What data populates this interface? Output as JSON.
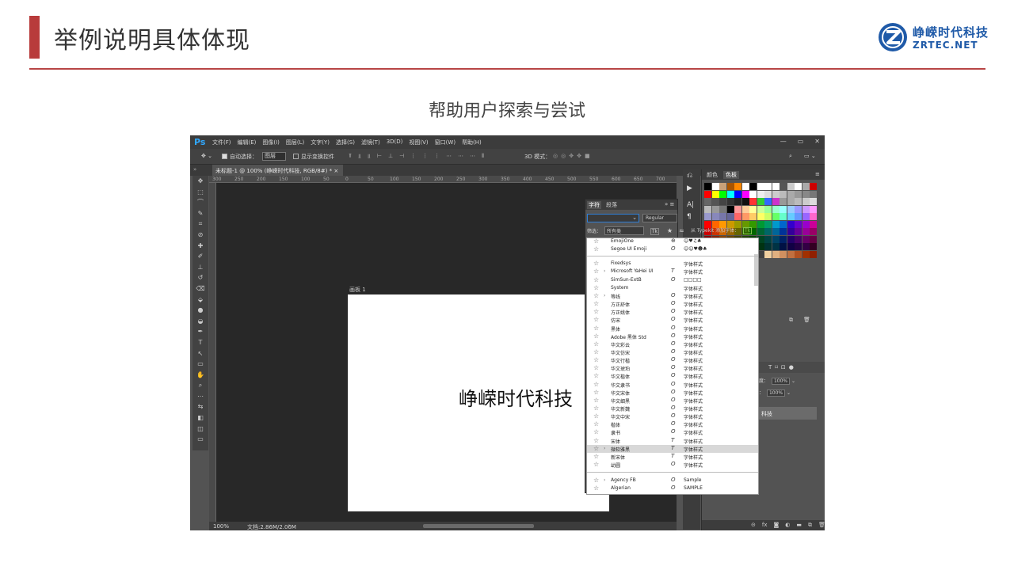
{
  "slide": {
    "title": "举例说明具体体现",
    "subtitle": "帮助用户探索与尝试",
    "logo_cn": "峥嵘时代科技",
    "logo_en": "ZRTEC.NET"
  },
  "ps": {
    "logo": "Ps",
    "menu": [
      "文件(F)",
      "编辑(E)",
      "图像(I)",
      "图层(L)",
      "文字(Y)",
      "选择(S)",
      "滤镜(T)",
      "3D(D)",
      "视图(V)",
      "窗口(W)",
      "帮助(H)"
    ],
    "options": {
      "auto_select_label": "自动选择：",
      "auto_select_value": "图层",
      "transform_label": "显示变换控件",
      "mode_3d": "3D 模式："
    },
    "doc_tab": "未标题-1 @ 100% (峥嵘时代科技, RGB/8#) *",
    "artboard_label": "画板 1",
    "canvas_text": "峥嵘时代科技",
    "status_zoom": "100%",
    "status_doc": "文档:2.86M/2.00M",
    "ruler_ticks": [
      "300",
      "250",
      "200",
      "150",
      "100",
      "50",
      "0",
      "50",
      "100",
      "150",
      "200",
      "250",
      "300",
      "350",
      "400",
      "450",
      "500",
      "550",
      "600",
      "650",
      "700"
    ],
    "tools": [
      "move-tool",
      "marquee-tool",
      "lasso-tool",
      "quick-select-tool",
      "crop-tool",
      "eyedropper-tool",
      "healing-tool",
      "brush-tool",
      "stamp-tool",
      "history-brush-tool",
      "eraser-tool",
      "bucket-tool",
      "blur-tool",
      "dodge-tool",
      "pen-tool",
      "type-tool",
      "path-select-tool",
      "rectangle-tool",
      "hand-tool",
      "zoom-tool",
      "more-tool",
      "swap-colors",
      "color-swatches",
      "mask-mode",
      "screen-mode"
    ],
    "right_panel": {
      "tab_color": "颜色",
      "tab_swatches": "色板",
      "opacity_label": "透明度：",
      "opacity_value": "100%",
      "fill_label": "填充：",
      "fill_value": "100%",
      "layer_name": "科技"
    },
    "character": {
      "tab_char": "字符",
      "tab_para": "段落",
      "style_value": "Regular",
      "filter_label": "筛选：",
      "filter_value": "所有类",
      "typekit_label": "从 Typekit 添加字体："
    },
    "fonts_top": [
      {
        "name": "EmojiOne",
        "type": "⊕",
        "sample": "☺♥♫♣"
      },
      {
        "name": "Segoe UI Emoji",
        "type": "O",
        "sample": "☺☺♥☻♣"
      }
    ],
    "fonts_mid": [
      {
        "name": "Fixedsys",
        "type": "",
        "sample": "字体样式",
        "exp": ""
      },
      {
        "name": "Microsoft YaHei UI",
        "type": "T",
        "sample": "字体样式",
        "exp": "›"
      },
      {
        "name": "SimSun-ExtB",
        "type": "O",
        "sample": "□□□□",
        "exp": ""
      },
      {
        "name": "System",
        "type": "",
        "sample": "字体样式",
        "exp": ""
      },
      {
        "name": "等线",
        "type": "O",
        "sample": "字体样式",
        "exp": "›"
      },
      {
        "name": "方正舒体",
        "type": "O",
        "sample": "字体样式",
        "exp": ""
      },
      {
        "name": "方正姚体",
        "type": "O",
        "sample": "字体样式",
        "exp": ""
      },
      {
        "name": "仿宋",
        "type": "O",
        "sample": "字体样式",
        "exp": ""
      },
      {
        "name": "黑体",
        "type": "O",
        "sample": "字体样式",
        "exp": ""
      },
      {
        "name": "Adobe 黑体 Std",
        "type": "O",
        "sample": "字体样式",
        "exp": ""
      },
      {
        "name": "华文彩云",
        "type": "O",
        "sample": "字体样式",
        "exp": ""
      },
      {
        "name": "华文仿宋",
        "type": "O",
        "sample": "字体样式",
        "exp": ""
      },
      {
        "name": "华文行楷",
        "type": "O",
        "sample": "字体样式",
        "exp": ""
      },
      {
        "name": "华文琥珀",
        "type": "O",
        "sample": "字体样式",
        "exp": ""
      },
      {
        "name": "华文楷体",
        "type": "O",
        "sample": "字体样式",
        "exp": ""
      },
      {
        "name": "华文隶书",
        "type": "O",
        "sample": "字体样式",
        "exp": ""
      },
      {
        "name": "华文宋体",
        "type": "O",
        "sample": "字体样式",
        "exp": ""
      },
      {
        "name": "华文细黑",
        "type": "O",
        "sample": "字体样式",
        "exp": ""
      },
      {
        "name": "华文新魏",
        "type": "O",
        "sample": "字体样式",
        "exp": ""
      },
      {
        "name": "华文中宋",
        "type": "O",
        "sample": "字体样式",
        "exp": ""
      },
      {
        "name": "楷体",
        "type": "O",
        "sample": "字体样式",
        "exp": ""
      },
      {
        "name": "隶书",
        "type": "O",
        "sample": "字体样式",
        "exp": ""
      },
      {
        "name": "宋体",
        "type": "T",
        "sample": "字体样式",
        "exp": ""
      },
      {
        "name": "微软雅黑",
        "type": "T",
        "sample": "字体样式",
        "exp": "›",
        "hl": true
      },
      {
        "name": "新宋体",
        "type": "T",
        "sample": "字体样式",
        "exp": ""
      },
      {
        "name": "幼圆",
        "type": "O",
        "sample": "字体样式",
        "exp": ""
      }
    ],
    "fonts_bottom": [
      {
        "name": "Agency FB",
        "type": "O",
        "sample": "Sample",
        "exp": "›"
      },
      {
        "name": "Algerian",
        "type": "O",
        "sample": "SAMPLE",
        "exp": ""
      }
    ]
  },
  "colors": {
    "accent": "#b83b3b",
    "logo_blue": "#1f5aa8",
    "ps_blue": "#31a8ff"
  }
}
